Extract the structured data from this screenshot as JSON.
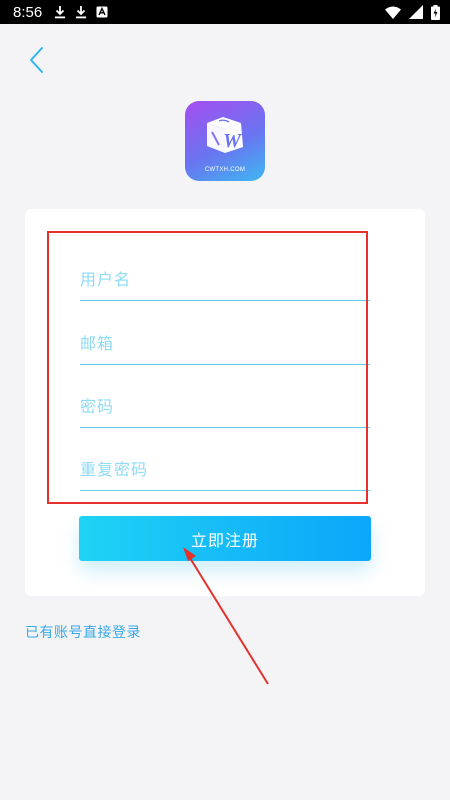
{
  "status_bar": {
    "time": "8:56",
    "left_icons": [
      "download-icon",
      "download-icon",
      "app-notification-icon"
    ],
    "right_icons": [
      "wifi-icon",
      "signal-icon",
      "battery-icon"
    ]
  },
  "nav": {
    "back_icon": "chevron-left-icon"
  },
  "logo": {
    "caption": "CWTXH.COM",
    "letter": "W"
  },
  "form": {
    "username_placeholder": "用户名",
    "email_placeholder": "邮箱",
    "password_placeholder": "密码",
    "confirm_password_placeholder": "重复密码"
  },
  "register_button": {
    "label": "立即注册"
  },
  "login_link": {
    "label": "已有账号直接登录"
  },
  "colors": {
    "accent": "#1ab8f5",
    "placeholder": "#8fdaf4",
    "link": "#39a8e6",
    "annotation_red": "#e4312b",
    "logo_gradient": [
      "#a54ef0",
      "#6a74f0",
      "#3db8f2"
    ]
  }
}
